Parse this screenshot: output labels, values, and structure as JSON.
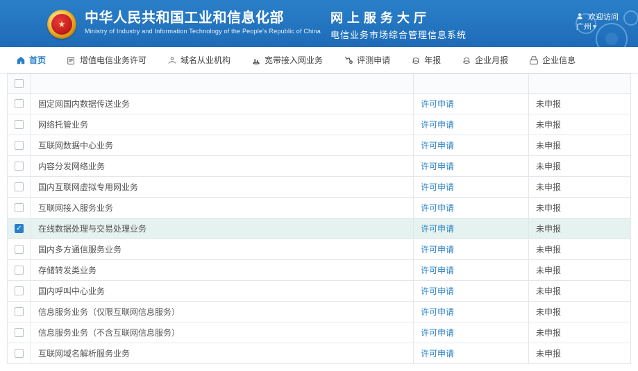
{
  "header": {
    "title_cn": "中华人民共和国工业和信息化部",
    "title_en": "Ministry of Industry and Information Technology of the People's Republic of China",
    "title_r1": "网上服务大厅",
    "title_r2": "电信业务市场综合管理信息系统",
    "welcome_prefix": "欢迎访问",
    "location": "广州"
  },
  "nav": {
    "home": "首页",
    "items": [
      "增值电信业务许可",
      "域名从业机构",
      "宽带接入网业务",
      "评测申请",
      "年报",
      "企业月报",
      "企业信息"
    ]
  },
  "table": {
    "action_label": "许可申请",
    "status_label": "未申报",
    "rows": [
      {
        "name": "固定网国内数据传送业务",
        "checked": false
      },
      {
        "name": "网络托管业务",
        "checked": false
      },
      {
        "name": "互联网数据中心业务",
        "checked": false
      },
      {
        "name": "内容分发网络业务",
        "checked": false
      },
      {
        "name": "国内互联网虚拟专用网业务",
        "checked": false
      },
      {
        "name": "互联网接入服务业务",
        "checked": false
      },
      {
        "name": "在线数据处理与交易处理业务",
        "checked": true
      },
      {
        "name": "国内多方通信服务业务",
        "checked": false
      },
      {
        "name": "存储转发类业务",
        "checked": false
      },
      {
        "name": "国内呼叫中心业务",
        "checked": false
      },
      {
        "name": "信息服务业务（仅限互联网信息服务）",
        "checked": false
      },
      {
        "name": "信息服务业务（不含互联网信息服务）",
        "checked": false
      },
      {
        "name": "互联网域名解析服务业务",
        "checked": false
      }
    ]
  },
  "colors": {
    "primary": "#2a80c8",
    "row_selected": "#e6f2ef",
    "border": "#e3e7eb"
  }
}
